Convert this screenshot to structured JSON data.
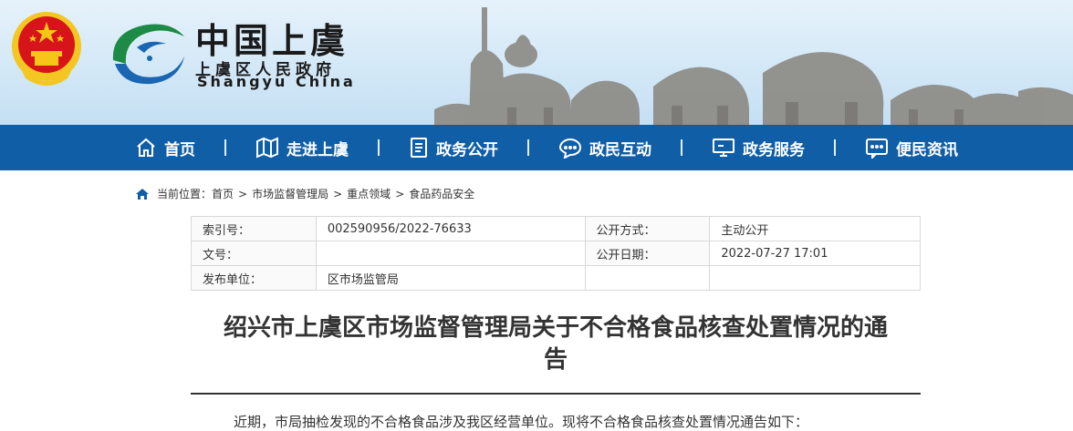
{
  "header": {
    "title_cn": "中国上虞",
    "subtitle_cn": "上虞区人民政府",
    "subtitle_en": "Shangyu  China"
  },
  "nav": {
    "items": [
      {
        "label": "首页",
        "icon": "home-icon"
      },
      {
        "label": "走进上虞",
        "icon": "map-icon"
      },
      {
        "label": "政务公开",
        "icon": "document-icon"
      },
      {
        "label": "政民互动",
        "icon": "chat-icon"
      },
      {
        "label": "政务服务",
        "icon": "monitor-icon"
      },
      {
        "label": "便民资讯",
        "icon": "message-icon"
      }
    ]
  },
  "breadcrumb": {
    "prefix": "当前位置：",
    "items": [
      "首页",
      "市场监督管理局",
      "重点领域",
      "食品药品安全"
    ]
  },
  "meta": {
    "index_label": "索引号：",
    "index_value": "002590956/2022-76633",
    "method_label": "公开方式：",
    "method_value": "主动公开",
    "doc_label": "文号：",
    "doc_value": "",
    "date_label": "公开日期：",
    "date_value": "2022-07-27 17:01",
    "unit_label": "发布单位：",
    "unit_value": "区市场监管局"
  },
  "article": {
    "title_line1": "绍兴市上虞区市场监督管理局关于不合格食品核查处置情况的通",
    "title_line2": "告",
    "intro": "近期，市局抽检发现的不合格食品涉及我区经营单位。现将不合格食品核查处置情况通告如下："
  },
  "colors": {
    "nav_bg": "#105ea6",
    "emblem_red": "#d7141a",
    "gold": "#f5c518"
  }
}
